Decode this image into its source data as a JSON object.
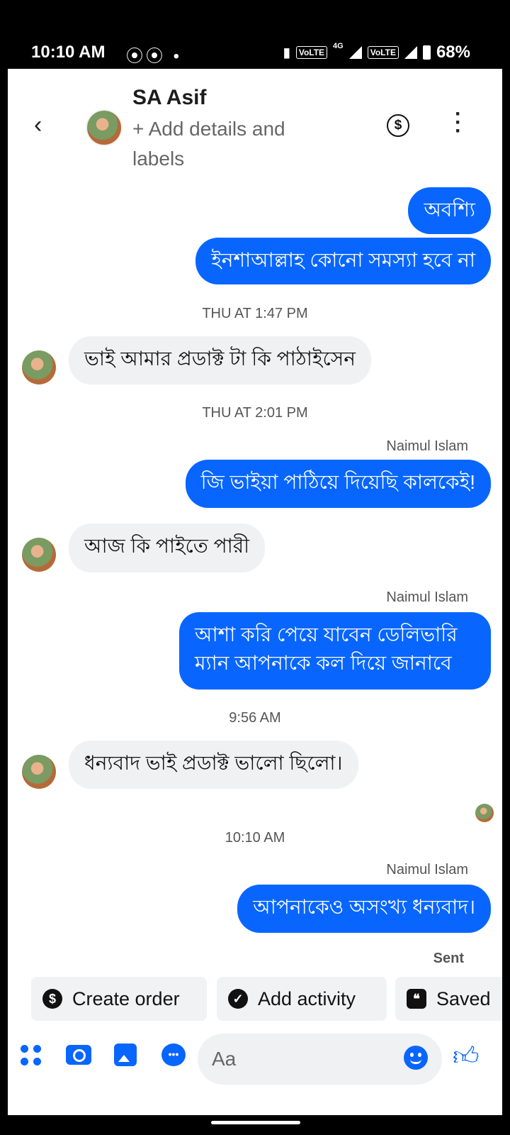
{
  "status_bar": {
    "time": "10:10 AM",
    "left_icons": "⦿⦿ •",
    "volte1": "VoLTE",
    "network": "4G",
    "volte2": "VoLTE",
    "battery": "68%"
  },
  "header": {
    "name": "SA Asif",
    "details": "+ Add details and labels",
    "icons": [
      "chevron-left-icon",
      "avatar",
      "dollar-circle-icon",
      "more-vertical-icon"
    ]
  },
  "messages": [
    {
      "dir": "out",
      "text": "অবশ্যি"
    },
    {
      "dir": "out",
      "text": "ইনশাআল্লাহ কোনো সমস্যা হবে না"
    },
    {
      "ts": "THU AT 1:47 PM"
    },
    {
      "dir": "in",
      "text": "ভাই আমার প্রডাক্ট টা কি পাঠাইসেন"
    },
    {
      "ts": "THU AT 2:01 PM"
    },
    {
      "sender": "Naimul Islam"
    },
    {
      "dir": "out",
      "text": "জি ভাইয়া পাঠিয়ে দিয়েছি কালকেই!"
    },
    {
      "dir": "in",
      "text": "আজ কি পাইতে পারী"
    },
    {
      "sender": "Naimul Islam"
    },
    {
      "dir": "out",
      "text": "আশা করি পেয়ে যাবেন ডেলিভারি ম্যান আপনাকে কল দিয়ে জানাবে"
    },
    {
      "ts": "9:56 AM"
    },
    {
      "dir": "in",
      "text": "ধন্যবাদ ভাই প্রডাক্ট ভালো ছিলো।"
    },
    {
      "ts": "10:10 AM"
    },
    {
      "sender": "Naimul Islam"
    },
    {
      "dir": "out",
      "text": "আপনাকেও অসংখ্য ধন্যবাদ।"
    }
  ],
  "status_sent": "Sent",
  "chips": [
    "Create order",
    "Add activity",
    "Saved"
  ],
  "composer": {
    "placeholder": "Aa"
  },
  "colors": {
    "outgoing_bubble": "#0866ff",
    "incoming_bubble": "#f0f1f3"
  }
}
